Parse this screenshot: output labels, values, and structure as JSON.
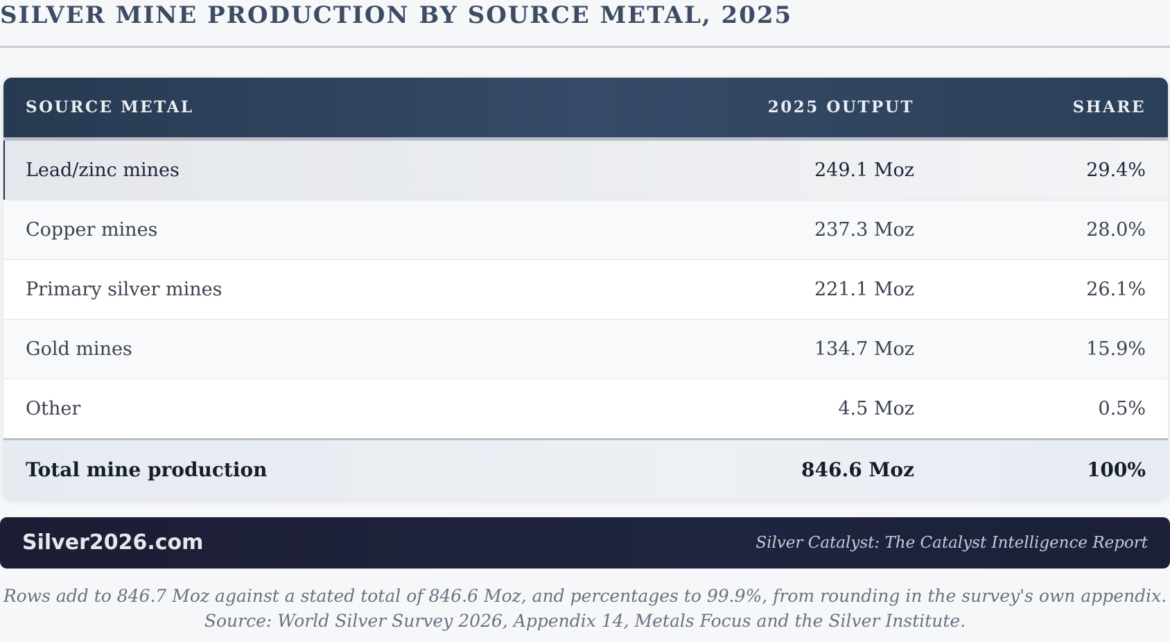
{
  "title": "SILVER MINE PRODUCTION BY SOURCE METAL, 2025",
  "table": {
    "headers": {
      "source": "SOURCE METAL",
      "output": "2025 OUTPUT",
      "share": "SHARE"
    },
    "rows": [
      {
        "source": "Lead/zinc mines",
        "output": "249.1 Moz",
        "share": "29.4%"
      },
      {
        "source": "Copper mines",
        "output": "237.3 Moz",
        "share": "28.0%"
      },
      {
        "source": "Primary silver mines",
        "output": "221.1 Moz",
        "share": "26.1%"
      },
      {
        "source": "Gold mines",
        "output": "134.7 Moz",
        "share": "15.9%"
      },
      {
        "source": "Other",
        "output": "4.5 Moz",
        "share": "0.5%"
      }
    ],
    "total": {
      "source": "Total mine production",
      "output": "846.6 Moz",
      "share": "100%"
    }
  },
  "footer": {
    "brand": "Silver2026.com",
    "report": "Silver Catalyst: The Catalyst Intelligence Report"
  },
  "notes": {
    "rounding": "Rows add to 846.7 Moz against a stated total of 846.6 Moz, and percentages to 99.9%, from rounding in the survey's own appendix.",
    "source": "Source: World Silver Survey 2026, Appendix 14, Metals Focus and the Silver Institute."
  }
}
